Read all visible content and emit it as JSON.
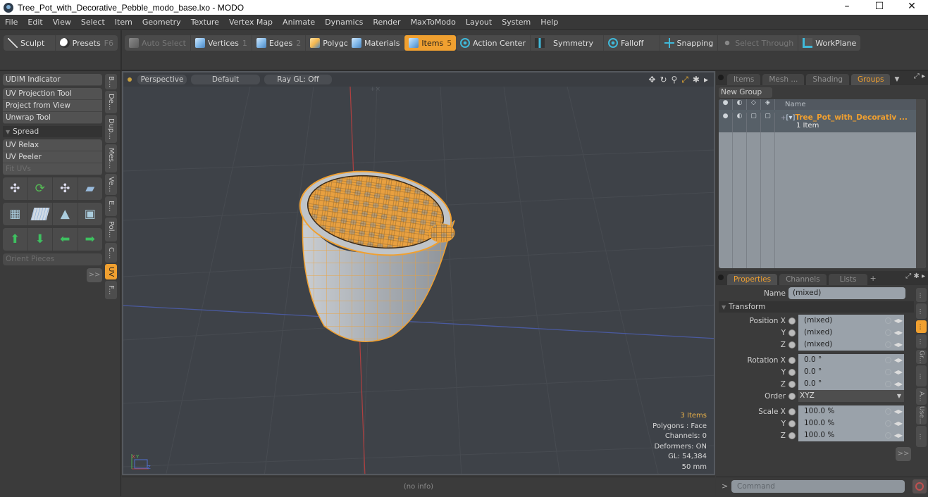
{
  "window": {
    "title": "Tree_Pot_with_Decorative_Pebble_modo_base.lxo - MODO",
    "controls": {
      "minimize": "–",
      "maximize": "☐",
      "close": "✕"
    }
  },
  "menu": [
    "File",
    "Edit",
    "View",
    "Select",
    "Item",
    "Geometry",
    "Texture",
    "Vertex Map",
    "Animate",
    "Dynamics",
    "Render",
    "MaxToModo",
    "Layout",
    "System",
    "Help"
  ],
  "toolbar": {
    "sculpt": "Sculpt",
    "presets": "Presets",
    "presets_key": "F6",
    "auto_select": "Auto Select",
    "vertices": "Vertices",
    "vertices_key": "1",
    "edges": "Edges",
    "edges_key": "2",
    "polygons": "Polygons",
    "materials": "Materials",
    "items": "Items",
    "items_key": "5",
    "action_center": "Action Center",
    "symmetry": "Symmetry",
    "falloff": "Falloff",
    "snapping": "Snapping",
    "select_through": "Select Through",
    "workplane": "WorkPlane"
  },
  "left_panel": {
    "udim": "UDIM Indicator",
    "tools": [
      "UV Projection Tool",
      "Project from View",
      "Unwrap Tool"
    ],
    "spread_section": "Spread",
    "tools2": [
      "UV Relax",
      "UV Peeler",
      "Fit UVs"
    ],
    "orient_pieces": "Orient Pieces",
    "more": ">>",
    "vertical_tabs": [
      "B...",
      "De...",
      "Dup...",
      "Mes...",
      "Ve...",
      "E...",
      "Pol...",
      "C...",
      "UV",
      "F..."
    ]
  },
  "viewport": {
    "view_mode": "Perspective",
    "shading": "Default",
    "raygl": "Ray GL: Off",
    "info": {
      "items": "3 Items",
      "polygons": "Polygons : Face",
      "channels": "Channels: 0",
      "deformers": "Deformers: ON",
      "gl": "GL: 54,384",
      "scale": "50 mm"
    },
    "status": "(no info)"
  },
  "groups_panel": {
    "tabs": [
      "Items",
      "Mesh ...",
      "Shading",
      "Groups"
    ],
    "active_tab": "Groups",
    "new_group": "New Group",
    "column_name": "Name",
    "item_name": "Tree_Pot_with_Decorativ ...",
    "item_count": "1 Item"
  },
  "properties_panel": {
    "tabs": [
      "Properties",
      "Channels",
      "Lists",
      "+"
    ],
    "active_tab": "Properties",
    "name_label": "Name",
    "name_value": "(mixed)",
    "transform_section": "Transform",
    "position": {
      "label_x": "Position X",
      "x": "(mixed)",
      "y": "(mixed)",
      "z": "(mixed)"
    },
    "rotation": {
      "label_x": "Rotation X",
      "x": "0.0 °",
      "y": "0.0 °",
      "z": "0.0 °"
    },
    "order": {
      "label": "Order",
      "value": "XYZ"
    },
    "scale": {
      "label_x": "Scale X",
      "x": "100.0 %",
      "y": "100.0 %",
      "z": "100.0 %"
    },
    "axis_y": "Y",
    "axis_z": "Z",
    "more": ">>",
    "side_tabs": [
      "...",
      "...",
      "...",
      "...",
      "Gr...",
      "...",
      "A...",
      "Use...",
      "..."
    ]
  },
  "command": {
    "prompt": ">",
    "placeholder": "Command"
  }
}
